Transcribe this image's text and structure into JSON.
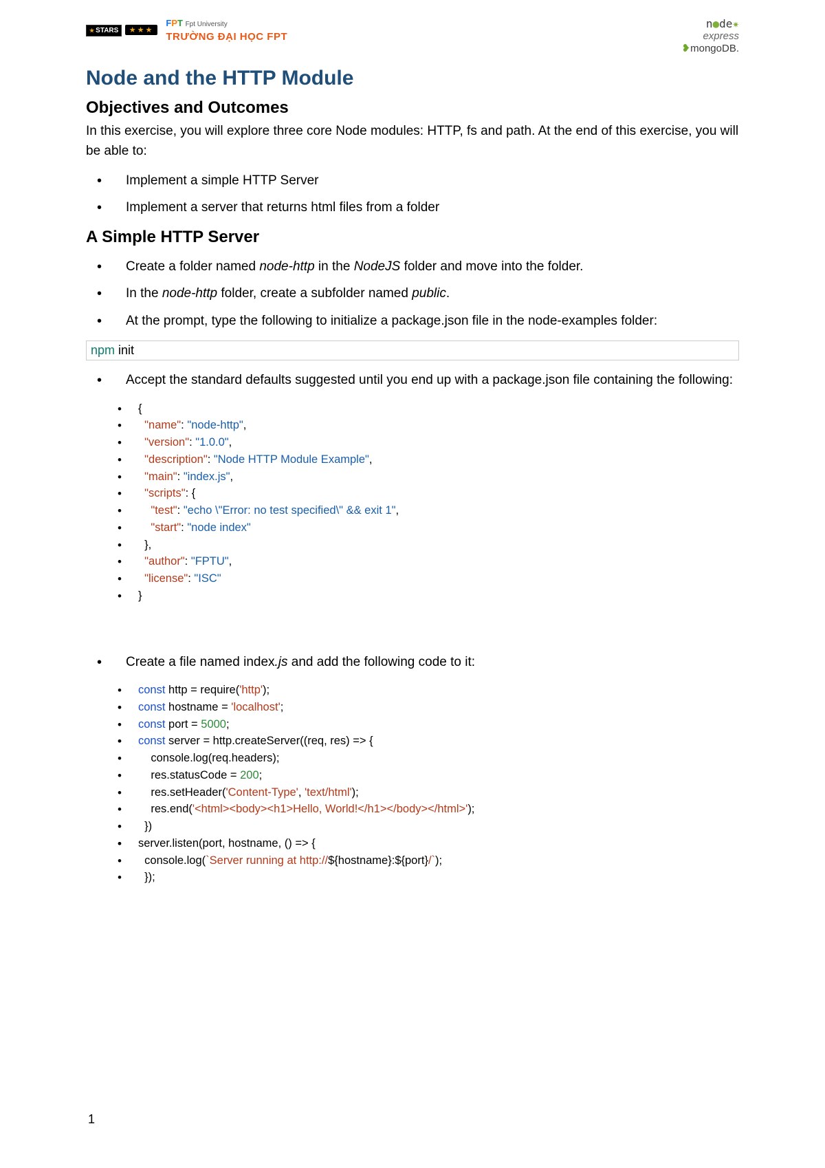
{
  "header": {
    "stars_label": "STARS",
    "fpt_sub": "Fpt University",
    "truong": "TRƯỜNG ĐẠI HỌC FPT",
    "right_node": "n  de",
    "right_express": "express",
    "right_mongo": "mongoDB"
  },
  "title": "Node and the HTTP Module",
  "h2_objectives": "Objectives and Outcomes",
  "intro": "In this exercise, you will explore three core Node modules: HTTP, fs and path. At the end of this exercise, you will be able to:",
  "objectives": [
    "Implement a simple HTTP Server",
    "Implement a server that returns html files from a folder"
  ],
  "h2_simple": "A Simple HTTP Server",
  "steps_a": {
    "s1_pre": "Create a folder named ",
    "s1_it1": "node-http",
    "s1_mid": " in the ",
    "s1_it2": "NodeJS",
    "s1_post": " folder and move into the folder.",
    "s2_pre": "In the ",
    "s2_it1": "node-http",
    "s2_mid": " folder, create a subfolder named ",
    "s2_it2": "public",
    "s2_post": ".",
    "s3": "At the prompt, type the following to initialize a package.json file in the node-examples folder:"
  },
  "cmd": {
    "kw": "npm",
    "rest": " init"
  },
  "accept_text": "Accept the standard defaults suggested until you end up with a package.json file containing the following:",
  "package_json_lines": [
    [
      {
        "t": "{",
        "c": ""
      }
    ],
    [
      {
        "t": "  ",
        "c": ""
      },
      {
        "t": "\"name\"",
        "c": "c-key"
      },
      {
        "t": ": ",
        "c": ""
      },
      {
        "t": "\"node-http\"",
        "c": "c-str"
      },
      {
        "t": ",",
        "c": ""
      }
    ],
    [
      {
        "t": "  ",
        "c": ""
      },
      {
        "t": "\"version\"",
        "c": "c-key"
      },
      {
        "t": ": ",
        "c": ""
      },
      {
        "t": "\"1.0.0\"",
        "c": "c-str"
      },
      {
        "t": ",",
        "c": ""
      }
    ],
    [
      {
        "t": "  ",
        "c": ""
      },
      {
        "t": "\"description\"",
        "c": "c-key"
      },
      {
        "t": ": ",
        "c": ""
      },
      {
        "t": "\"Node HTTP Module Example\"",
        "c": "c-str"
      },
      {
        "t": ",",
        "c": ""
      }
    ],
    [
      {
        "t": "  ",
        "c": ""
      },
      {
        "t": "\"main\"",
        "c": "c-key"
      },
      {
        "t": ": ",
        "c": ""
      },
      {
        "t": "\"index.js\"",
        "c": "c-str"
      },
      {
        "t": ",",
        "c": ""
      }
    ],
    [
      {
        "t": "  ",
        "c": ""
      },
      {
        "t": "\"scripts\"",
        "c": "c-key"
      },
      {
        "t": ": {",
        "c": ""
      }
    ],
    [
      {
        "t": "    ",
        "c": ""
      },
      {
        "t": "\"test\"",
        "c": "c-key"
      },
      {
        "t": ": ",
        "c": ""
      },
      {
        "t": "\"echo \\\"Error: no test specified\\\" && exit 1\"",
        "c": "c-str"
      },
      {
        "t": ",",
        "c": ""
      }
    ],
    [
      {
        "t": "    ",
        "c": ""
      },
      {
        "t": "\"start\"",
        "c": "c-key"
      },
      {
        "t": ": ",
        "c": ""
      },
      {
        "t": "\"node index\"",
        "c": "c-str"
      }
    ],
    [
      {
        "t": "  },",
        "c": ""
      }
    ],
    [
      {
        "t": "  ",
        "c": ""
      },
      {
        "t": "\"author\"",
        "c": "c-key"
      },
      {
        "t": ": ",
        "c": ""
      },
      {
        "t": "\"FPTU\"",
        "c": "c-str"
      },
      {
        "t": ",",
        "c": ""
      }
    ],
    [
      {
        "t": "  ",
        "c": ""
      },
      {
        "t": "\"license\"",
        "c": "c-key"
      },
      {
        "t": ": ",
        "c": ""
      },
      {
        "t": "\"ISC\"",
        "c": "c-str"
      }
    ],
    [
      {
        "t": "}",
        "c": ""
      }
    ]
  ],
  "step_index_pre": "Create a file named index",
  "step_index_it": ".js",
  "step_index_post": " and add the following code to it:",
  "index_lines": [
    [
      {
        "t": "const",
        "c": "c-kw"
      },
      {
        "t": " http = require(",
        "c": ""
      },
      {
        "t": "'http'",
        "c": "c-tpl"
      },
      {
        "t": ");",
        "c": ""
      }
    ],
    [
      {
        "t": "",
        "c": ""
      }
    ],
    [
      {
        "t": "const",
        "c": "c-kw"
      },
      {
        "t": " hostname = ",
        "c": ""
      },
      {
        "t": "'localhost'",
        "c": "c-tpl"
      },
      {
        "t": ";",
        "c": ""
      }
    ],
    [
      {
        "t": "const",
        "c": "c-kw"
      },
      {
        "t": " port = ",
        "c": ""
      },
      {
        "t": "5000",
        "c": "c-num"
      },
      {
        "t": ";",
        "c": ""
      }
    ],
    [
      {
        "t": "",
        "c": ""
      }
    ],
    [
      {
        "t": "const",
        "c": "c-kw"
      },
      {
        "t": " server = http.createServer((req, res) => {",
        "c": ""
      }
    ],
    [
      {
        "t": "    console.log(req.headers);",
        "c": ""
      }
    ],
    [
      {
        "t": "    res.statusCode = ",
        "c": ""
      },
      {
        "t": "200",
        "c": "c-num"
      },
      {
        "t": ";",
        "c": ""
      }
    ],
    [
      {
        "t": "    res.setHeader(",
        "c": ""
      },
      {
        "t": "'Content-Type'",
        "c": "c-tpl"
      },
      {
        "t": ", ",
        "c": ""
      },
      {
        "t": "'text/html'",
        "c": "c-tpl"
      },
      {
        "t": ");",
        "c": ""
      }
    ],
    [
      {
        "t": "    res.end(",
        "c": ""
      },
      {
        "t": "'<html><body><h1>Hello, World!</h1></body></html>'",
        "c": "c-tpl"
      },
      {
        "t": ");",
        "c": ""
      }
    ],
    [
      {
        "t": "  })",
        "c": ""
      }
    ],
    [
      {
        "t": "",
        "c": ""
      }
    ],
    [
      {
        "t": "server.listen(port, hostname, () => {",
        "c": ""
      }
    ],
    [
      {
        "t": "  console.log(",
        "c": ""
      },
      {
        "t": "`Server running at http://",
        "c": "c-tpl"
      },
      {
        "t": "${hostname}:${port}",
        "c": ""
      },
      {
        "t": "/`",
        "c": "c-tpl"
      },
      {
        "t": ");",
        "c": ""
      }
    ],
    [
      {
        "t": "  });",
        "c": ""
      }
    ]
  ],
  "page_number": "1"
}
